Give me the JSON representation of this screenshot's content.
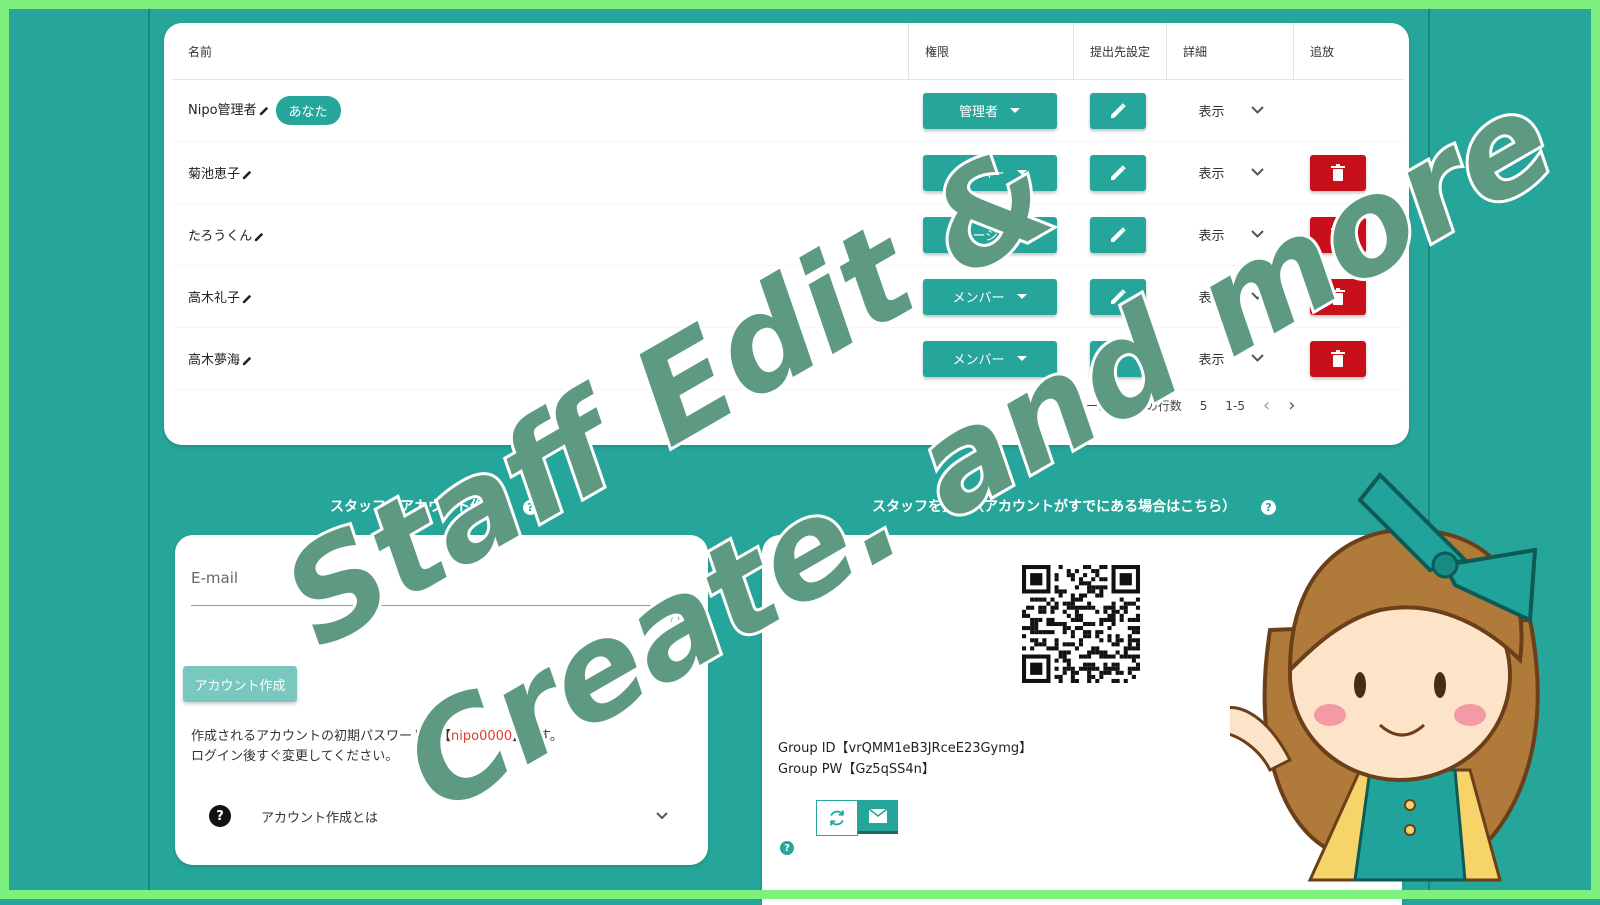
{
  "staff_table": {
    "headers": {
      "name": "名前",
      "role": "権限",
      "submission": "提出先設定",
      "detail": "詳細",
      "remove": "追放"
    },
    "rows": [
      {
        "name": "Nipo管理者",
        "you_badge": "あなた",
        "role": "管理者",
        "detail": "表示",
        "can_delete": false
      },
      {
        "name": "菊池恵子",
        "role": "メンバー",
        "detail": "表示",
        "can_delete": true
      },
      {
        "name": "たろうくん",
        "role": "マネージャ",
        "detail": "表示",
        "can_delete": true
      },
      {
        "name": "高木礼子",
        "role": "メンバー",
        "detail": "表示",
        "can_delete": true
      },
      {
        "name": "高木夢海",
        "role": "メンバー",
        "detail": "表示",
        "can_delete": true
      }
    ],
    "pagination": {
      "rows_per_page_label": "ページあたりの行数",
      "rows_per_page": "5",
      "range": "1-5"
    }
  },
  "create_account": {
    "title": "スタッフのアカウント作成",
    "email_label": "E-mail",
    "counter": "0 / 64",
    "button": "アカウント作成",
    "note_line1": "作成されるアカウントの初期パスワードは【",
    "note_pw": "nipo0000",
    "note_line1_end": "】です。",
    "note_line2": "ログイン後すぐ変更してください。",
    "faq": "アカウント作成とは"
  },
  "invite": {
    "title": "スタッフを招待（アカウントがすでにある場合はこちら）",
    "group_id": "Group ID【vrQMM1eB3JRceE23Gymg】",
    "group_pw": "Group PW【Gz5qSS4n】"
  },
  "overlay": {
    "line1": "Staff Edit &",
    "line2": "Create. and more",
    "text_color": "#5e9a82"
  },
  "colors": {
    "accent": "#26a69a",
    "danger": "#c8101a",
    "frame": "#7ef07e"
  }
}
